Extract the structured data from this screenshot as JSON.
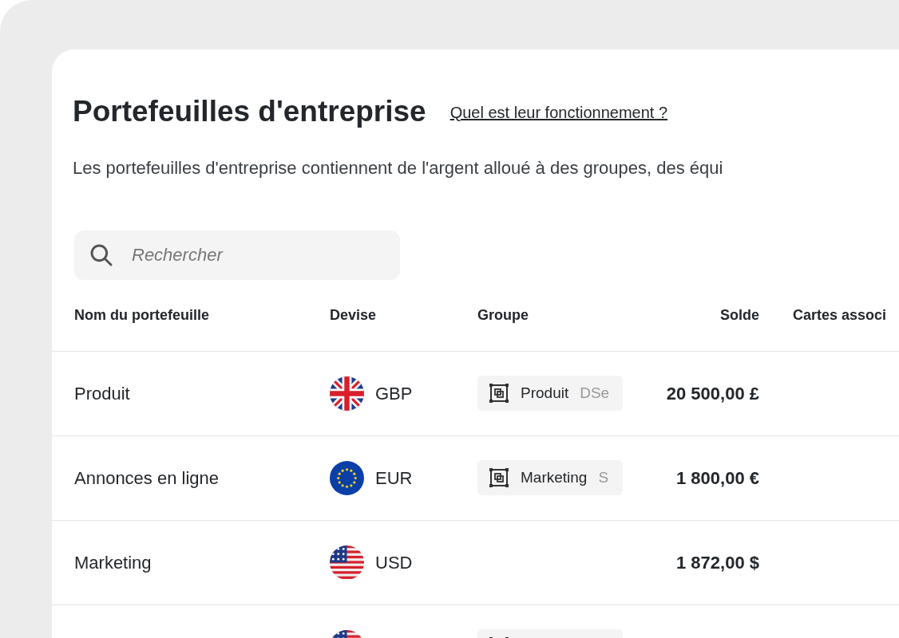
{
  "title": "Portefeuilles d'entreprise",
  "help_link": "Quel est leur fonctionnement ?",
  "description": "Les portefeuilles d'entreprise contiennent de l'argent alloué à des groupes, des équi",
  "search": {
    "placeholder": "Rechercher"
  },
  "columns": [
    "Nom du portefeuille",
    "Devise",
    "Groupe",
    "Solde",
    "Cartes associ"
  ],
  "rows": [
    {
      "name": "Produit",
      "flag": {
        "kind": "gb"
      },
      "currency": "GBP",
      "group": {
        "name": "Produit",
        "extra": "DSe"
      },
      "balance": "20 500,00 £"
    },
    {
      "name": "Annonces en ligne",
      "flag": {
        "kind": "eu"
      },
      "currency": "EUR",
      "group": {
        "name": "Marketing",
        "extra": "S"
      },
      "balance": "1 800,00 €"
    },
    {
      "name": "Marketing",
      "flag": {
        "kind": "us"
      },
      "currency": "USD",
      "balance": "1 872,00 $"
    },
    {
      "flag": {
        "kind": "us"
      },
      "group": {}
    }
  ]
}
